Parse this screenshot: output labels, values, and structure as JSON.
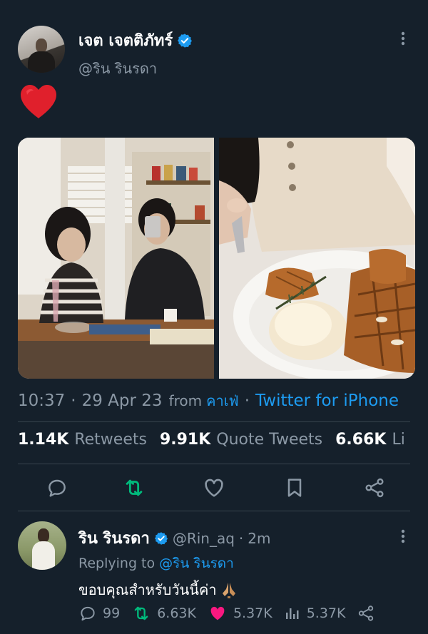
{
  "tweet": {
    "author": {
      "name": "เจต เจตติภัทร์",
      "handle": "@ริน รินรดา",
      "verified": true
    },
    "body_emoji": "red-heart",
    "timestamp": {
      "time": "10:37",
      "date": "29 Apr 23",
      "from_label": "from",
      "place": "คาเฟ่",
      "client": "Twitter for iPhone"
    },
    "stats": [
      {
        "value": "1.14K",
        "label": "Retweets"
      },
      {
        "value": "9.91K",
        "label": "Quote Tweets"
      },
      {
        "value": "6.66K",
        "label": "Li"
      }
    ],
    "actions": [
      "reply-icon",
      "retweet-icon",
      "like-icon",
      "bookmark-icon",
      "share-icon"
    ]
  },
  "reply": {
    "author": {
      "name": "ริน รินรดา",
      "handle": "@Rin_aq",
      "time": "2m",
      "verified": true
    },
    "replying_label": "Replying to",
    "replying_to": "@ริน รินรดา",
    "text": "ขอบคุณสำหรับวันนี้ค่า",
    "text_emoji": "folded-hands",
    "counts": {
      "replies": "99",
      "retweets": "6.63K",
      "likes": "5.37K",
      "views": "5.37K"
    }
  },
  "colors": {
    "background": "#15202b",
    "accent": "#1d9bf0",
    "muted": "#8b98a5",
    "retweet": "#00ba7c",
    "like": "#f91880",
    "divider": "#38444d"
  }
}
